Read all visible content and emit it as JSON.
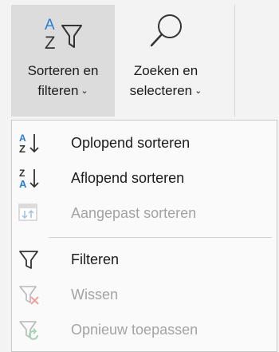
{
  "ribbon": {
    "sort_filter": {
      "label_line1": "Sorteren en",
      "label_line2": "filteren",
      "caret": "⌄",
      "icon": "sort-filter-icon"
    },
    "find_select": {
      "label_line1": "Zoeken en",
      "label_line2": "selecteren",
      "caret": "⌄",
      "icon": "magnifier-icon"
    }
  },
  "menu": {
    "items": [
      {
        "label": "Oplopend sorteren",
        "icon": "sort-ascending-icon",
        "enabled": true
      },
      {
        "label": "Aflopend sorteren",
        "icon": "sort-descending-icon",
        "enabled": true
      },
      {
        "label": "Aangepast sorteren",
        "icon": "custom-sort-icon",
        "enabled": false
      },
      {
        "label": "Filteren",
        "icon": "filter-icon",
        "enabled": true
      },
      {
        "label": "Wissen",
        "icon": "clear-filter-icon",
        "enabled": false
      },
      {
        "label": "Opnieuw toepassen",
        "icon": "reapply-filter-icon",
        "enabled": false
      }
    ]
  },
  "colors": {
    "accent_blue": "#2b7cd3",
    "red": "#e0463c",
    "green": "#2e9e5b",
    "disabled": "#a3a3a3"
  }
}
